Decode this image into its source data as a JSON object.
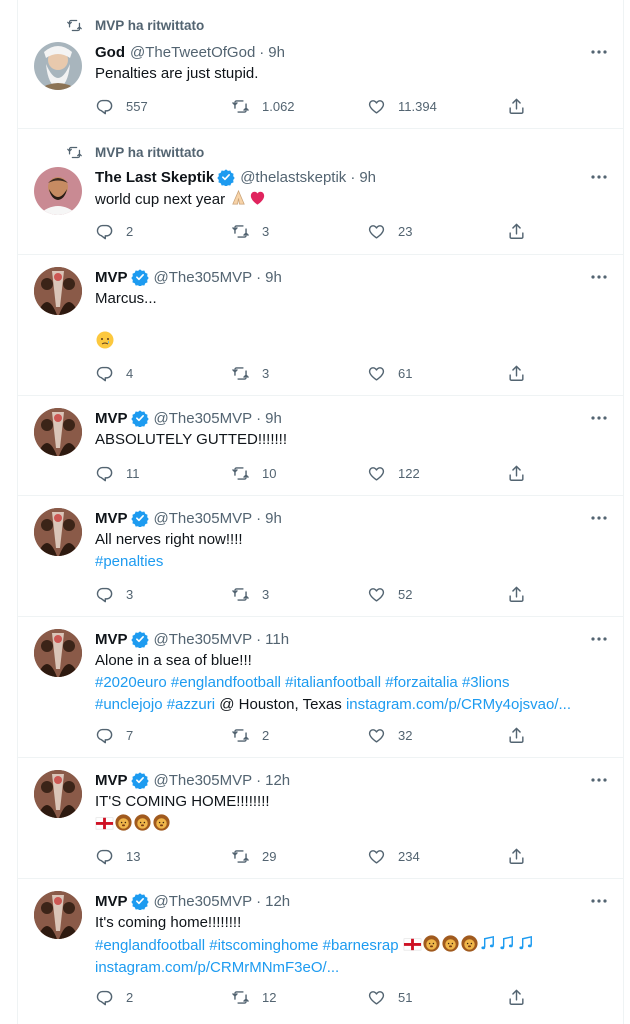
{
  "colors": {
    "accent": "#1d9bf0",
    "muted": "#536471",
    "text": "#0f1419",
    "heart": "#e0245e"
  },
  "tweets": [
    {
      "retweet_label": "MVP ha ritwittato",
      "name": "God",
      "handle": "@TheTweetOfGod",
      "time": "9h",
      "verified": false,
      "text": "Penalties are just stupid.",
      "avatar": "god-avatar",
      "replies": "557",
      "retweets": "1.062",
      "likes": "11.394"
    },
    {
      "retweet_label": "MVP ha ritwittato",
      "name": "The Last Skeptik",
      "handle": "@thelastskeptik",
      "time": "9h",
      "verified": true,
      "text": "world cup next year",
      "emojis": [
        "folded-hands",
        "red-heart"
      ],
      "avatar": "skeptik-avatar",
      "replies": "2",
      "retweets": "3",
      "likes": "23"
    },
    {
      "name": "MVP",
      "handle": "@The305MVP",
      "time": "9h",
      "verified": true,
      "text": "Marcus...",
      "emojis": [
        "crying-face"
      ],
      "avatar": "mvp-avatar",
      "replies": "4",
      "retweets": "3",
      "likes": "61"
    },
    {
      "name": "MVP",
      "handle": "@The305MVP",
      "time": "9h",
      "verified": true,
      "text": "ABSOLUTELY GUTTED!!!!!!!",
      "avatar": "mvp-avatar",
      "replies": "11",
      "retweets": "10",
      "likes": "122"
    },
    {
      "name": "MVP",
      "handle": "@The305MVP",
      "time": "9h",
      "verified": true,
      "text": "All nerves right now!!!!",
      "hashtags": "#penalties",
      "avatar": "mvp-avatar",
      "replies": "3",
      "retweets": "3",
      "likes": "52"
    },
    {
      "name": "MVP",
      "handle": "@The305MVP",
      "time": "11h",
      "verified": true,
      "text": "Alone in a sea of blue!!!",
      "hashtags_line1": "#2020euro #englandfootball #italianfootball #forzaitalia #3lions",
      "hashtags_line2": "#unclejojo #azzuri",
      "location": " @ Houston, Texas ",
      "link": "instagram.com/p/CRMy4ojsvao/...",
      "avatar": "mvp-avatar",
      "replies": "7",
      "retweets": "2",
      "likes": "32"
    },
    {
      "name": "MVP",
      "handle": "@The305MVP",
      "time": "12h",
      "verified": true,
      "text": "IT'S COMING HOME!!!!!!!!",
      "emojis": [
        "england-flag",
        "lion-face",
        "lion-face",
        "lion-face"
      ],
      "avatar": "mvp-avatar",
      "replies": "13",
      "retweets": "29",
      "likes": "234"
    },
    {
      "name": "MVP",
      "handle": "@The305MVP",
      "time": "12h",
      "verified": true,
      "text": "It's coming home!!!!!!!!",
      "hashtags": "#englandfootball #itscominghome #barnesrap",
      "emojis": [
        "england-flag",
        "lion-face",
        "lion-face",
        "lion-face",
        "music-notes",
        "music-notes",
        "music-notes"
      ],
      "link": "instagram.com/p/CRMrMNmF3eO/...",
      "avatar": "mvp-avatar",
      "replies": "2",
      "retweets": "12",
      "likes": "51"
    }
  ]
}
